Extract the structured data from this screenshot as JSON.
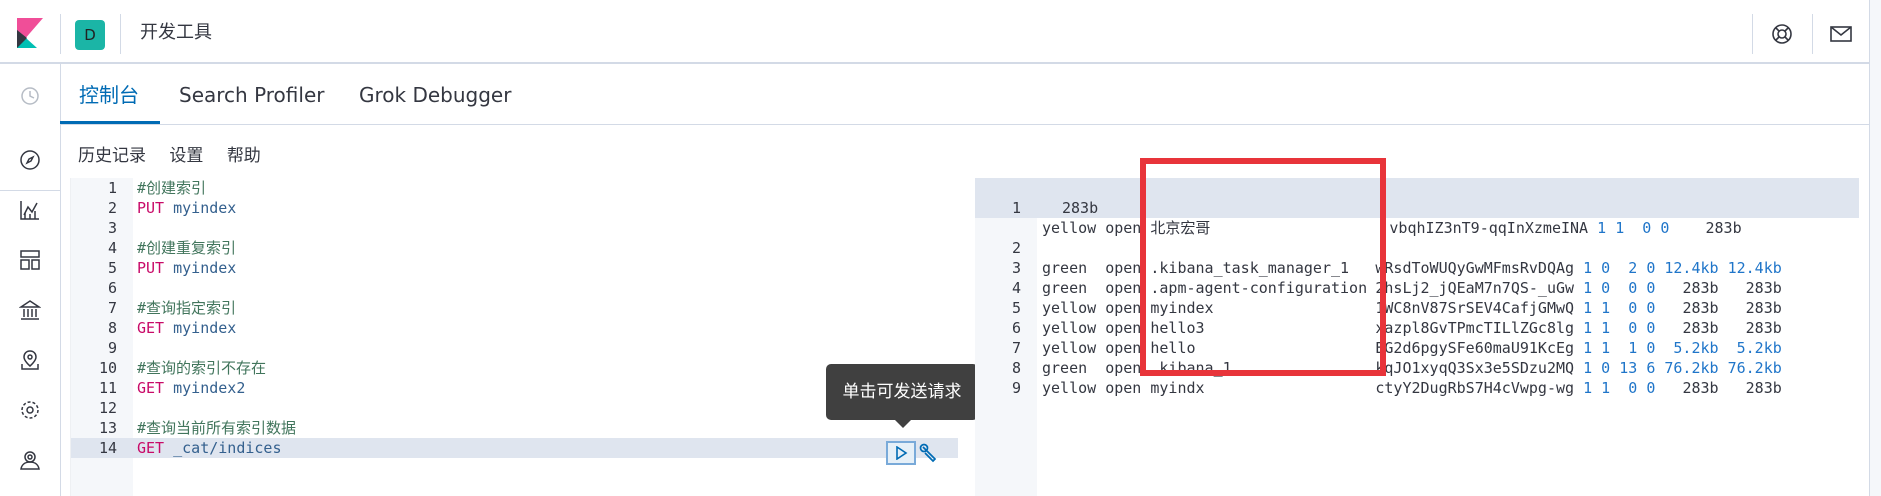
{
  "header": {
    "logo_icon": "kibana-logo-icon",
    "space_initial": "D",
    "breadcrumb": "开发工具",
    "help_icon": "help-lifebuoy-icon",
    "mail_icon": "mail-icon"
  },
  "sidenav": {
    "items": [
      {
        "icon": "clock-icon"
      },
      {
        "icon": "compass-discover-icon"
      },
      {
        "icon": "visualize-chart-icon"
      },
      {
        "icon": "dashboard-icon"
      },
      {
        "icon": "canvas-building-icon"
      },
      {
        "icon": "maps-icon"
      },
      {
        "icon": "ml-icon"
      },
      {
        "icon": "user-monitoring-icon"
      }
    ]
  },
  "tabs": [
    {
      "label": "控制台",
      "active": true
    },
    {
      "label": "Search Profiler",
      "active": false
    },
    {
      "label": "Grok Debugger",
      "active": false
    }
  ],
  "menu": {
    "history": "历史记录",
    "settings": "设置",
    "help": "帮助"
  },
  "editor": {
    "lines": [
      {
        "n": "1",
        "text": "#创建索引",
        "kind": "comment"
      },
      {
        "n": "2",
        "verb": "PUT",
        "path": "myindex",
        "kind": "request"
      },
      {
        "n": "3",
        "text": "",
        "kind": "blank"
      },
      {
        "n": "4",
        "text": "#创建重复索引",
        "kind": "comment"
      },
      {
        "n": "5",
        "verb": "PUT",
        "path": "myindex",
        "kind": "request"
      },
      {
        "n": "6",
        "text": "",
        "kind": "blank"
      },
      {
        "n": "7",
        "text": "#查询指定索引",
        "kind": "comment"
      },
      {
        "n": "8",
        "verb": "GET",
        "path": "myindex",
        "kind": "request"
      },
      {
        "n": "9",
        "text": "",
        "kind": "blank"
      },
      {
        "n": "10",
        "text": "#查询的索引不存在",
        "kind": "comment"
      },
      {
        "n": "11",
        "verb": "GET",
        "path": "myindex2",
        "kind": "request"
      },
      {
        "n": "12",
        "text": "",
        "kind": "blank"
      },
      {
        "n": "13",
        "text": "#查询当前所有索引数据",
        "kind": "comment"
      },
      {
        "n": "14",
        "verb": "GET",
        "path": "_cat/indices",
        "kind": "request",
        "active": true
      }
    ],
    "tooltip": "单击可发送请求",
    "run_icon": "play-icon",
    "wrench_icon": "wrench-icon"
  },
  "output": {
    "lines": [
      {
        "n": "1",
        "health": "yellow",
        "status": "open",
        "index": "北京宏哥",
        "uuid": "vbqhIZ3nT9-qqInXzmeINA",
        "pri": "1",
        "rep": "1",
        "docs": "0",
        "del": "0",
        "store": "283b",
        "pri_store": "283b",
        "wrap": true
      },
      {
        "n": "2",
        "health": "green",
        "status": "open",
        "index": ".kibana_task_manager_1",
        "uuid": "wRsdToWUQyGwMFmsRvDQAg",
        "pri": "1",
        "rep": "0",
        "docs": "2",
        "del": "0",
        "store": "12.4kb",
        "pri_store": "12.4kb"
      },
      {
        "n": "3",
        "health": "green",
        "status": "open",
        "index": ".apm-agent-configuration",
        "uuid": "2hsLj2_jQEaM7n7QS-_uGw",
        "pri": "1",
        "rep": "0",
        "docs": "0",
        "del": "0",
        "store": "283b",
        "pri_store": "283b"
      },
      {
        "n": "4",
        "health": "yellow",
        "status": "open",
        "index": "myindex",
        "uuid": "1WC8nV87SrSEV4CafjGMwQ",
        "pri": "1",
        "rep": "1",
        "docs": "0",
        "del": "0",
        "store": "283b",
        "pri_store": "283b"
      },
      {
        "n": "5",
        "health": "yellow",
        "status": "open",
        "index": "hello3",
        "uuid": "xazpl8GvTPmcTILlZGc8lg",
        "pri": "1",
        "rep": "1",
        "docs": "0",
        "del": "0",
        "store": "283b",
        "pri_store": "283b"
      },
      {
        "n": "6",
        "health": "yellow",
        "status": "open",
        "index": "hello",
        "uuid": "BG2d6pgySFe60maU91KcEg",
        "pri": "1",
        "rep": "1",
        "docs": "1",
        "del": "0",
        "store": "5.2kb",
        "pri_store": "5.2kb"
      },
      {
        "n": "7",
        "health": "green",
        "status": "open",
        "index": ".kibana_1",
        "uuid": "kqJO1xyqQ3Sx3e5SDzu2MQ",
        "pri": "1",
        "rep": "0",
        "docs": "13",
        "del": "6",
        "store": "76.2kb",
        "pri_store": "76.2kb"
      },
      {
        "n": "8",
        "health": "yellow",
        "status": "open",
        "index": "myindx",
        "uuid": "ctyY2DugRbS7H4cVwpg-wg",
        "pri": "1",
        "rep": "1",
        "docs": "0",
        "del": "0",
        "store": "283b",
        "pri_store": "283b"
      },
      {
        "n": "9"
      }
    ]
  },
  "annotation": {
    "highlight_color": "#e8343a"
  }
}
